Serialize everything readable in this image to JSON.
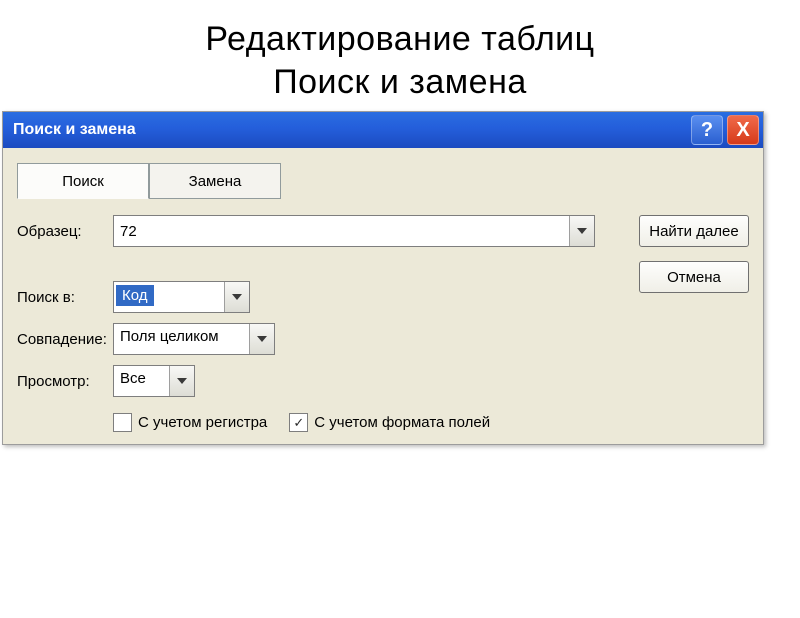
{
  "slide": {
    "title_line1": "Редактирование таблиц",
    "title_line2": "Поиск и замена"
  },
  "window": {
    "title": "Поиск и замена",
    "help_symbol": "?",
    "close_symbol": "X"
  },
  "tabs": {
    "search": "Поиск",
    "replace": "Замена"
  },
  "fields": {
    "pattern_label": "Образец:",
    "pattern_value": "72",
    "search_in_label": "Поиск в:",
    "search_in_value": "Код",
    "match_label": "Совпадение:",
    "match_value": "Поля целиком",
    "view_label": "Просмотр:",
    "view_value": "Все"
  },
  "buttons": {
    "find_next": "Найти далее",
    "cancel": "Отмена"
  },
  "checkboxes": {
    "case_sensitive": "С учетом регистра",
    "field_format": "С учетом формата полей",
    "checkmark": "✓"
  }
}
